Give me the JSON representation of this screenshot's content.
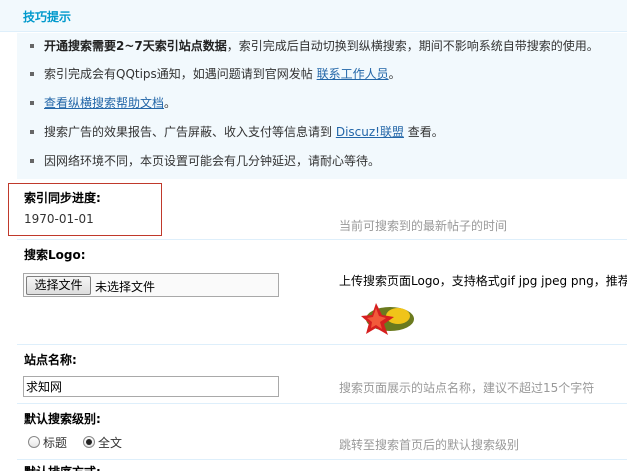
{
  "tips": {
    "title": "技巧提示",
    "items": [
      {
        "bold": "开通搜索需要2~7天索引站点数据",
        "text": "，索引完成后自动切换到纵横搜索，期间不影响系统自带搜索的使用。"
      },
      {
        "pre": "索引完成会有QQtips通知，如遇问题请到官网发帖 ",
        "link": "联系工作人员",
        "post": "。"
      },
      {
        "link": "查看纵横搜索帮助文档",
        "post": "。"
      },
      {
        "pre": "搜索广告的效果报告、广告屏蔽、收入支付等信息请到 ",
        "link": "Discuz!联盟",
        "post": " 查看。"
      },
      {
        "pre": "因网络环境不同，本页设置可能会有几分钟延迟，请耐心等待。"
      }
    ]
  },
  "index_progress": {
    "label": "索引同步进度:",
    "value": "1970-01-01",
    "hint": "当前可搜索到的最新帖子的时间"
  },
  "search_logo": {
    "label": "搜索Logo:",
    "button_label": "选择文件",
    "status": "未选择文件",
    "hint": "上传搜索页面Logo，支持格式gif jpg jpeg png，推荐"
  },
  "site_name": {
    "label": "站点名称:",
    "value": "求知网",
    "hint": "搜索页面展示的站点名称，建议不超过15个字符"
  },
  "default_level": {
    "label": "默认搜索级别:",
    "options": [
      "标题",
      "全文"
    ],
    "selected": "全文",
    "hint": "跳转至搜索首页后的默认搜索级别"
  },
  "next_section": {
    "label": "默认排序方式:"
  }
}
